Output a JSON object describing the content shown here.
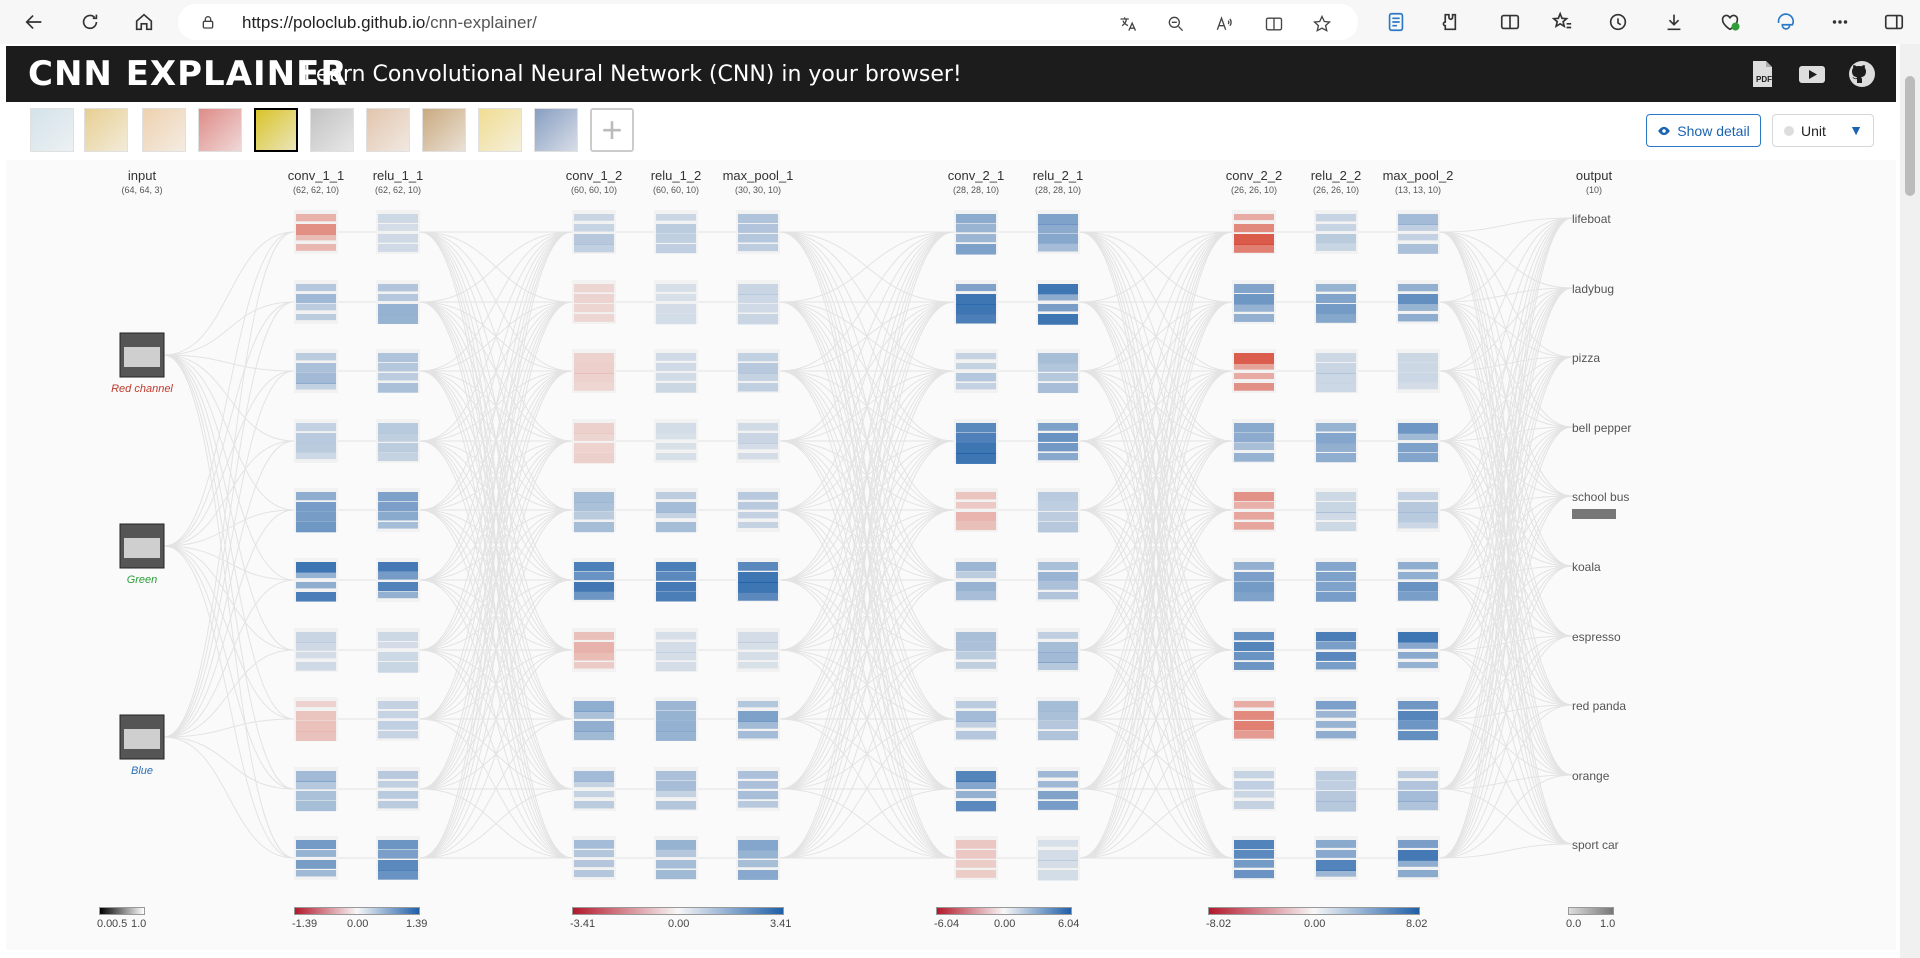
{
  "browser": {
    "url_host": "https://poloclub.github.io",
    "url_path": "/cnn-explainer/"
  },
  "header": {
    "title": "CNN EXPLAINER",
    "subtitle": "Learn Convolutional Neural Network (CNN) in your browser!"
  },
  "controls": {
    "show_detail": "Show detail",
    "unit_value": "Unit"
  },
  "images": [
    {
      "name": "lifeboat",
      "color": "#b7d0dc"
    },
    {
      "name": "ladybug",
      "color": "#d9b04a"
    },
    {
      "name": "pizza",
      "color": "#e3b37a"
    },
    {
      "name": "bell pepper",
      "color": "#c9403a"
    },
    {
      "name": "school bus",
      "color": "#d9c42a",
      "selected": true
    },
    {
      "name": "koala",
      "color": "#9a9a9a"
    },
    {
      "name": "espresso",
      "color": "#cf9f77"
    },
    {
      "name": "red panda",
      "color": "#a7722c"
    },
    {
      "name": "orange",
      "color": "#e8c74b"
    },
    {
      "name": "sport car",
      "color": "#3a5f9a"
    }
  ],
  "layers": [
    {
      "name": "input",
      "dim": "(64, 64, 3)"
    },
    {
      "name": "conv_1_1",
      "dim": "(62, 62, 10)"
    },
    {
      "name": "relu_1_1",
      "dim": "(62, 62, 10)"
    },
    {
      "name": "conv_1_2",
      "dim": "(60, 60, 10)"
    },
    {
      "name": "relu_1_2",
      "dim": "(60, 60, 10)"
    },
    {
      "name": "max_pool_1",
      "dim": "(30, 30, 10)"
    },
    {
      "name": "conv_2_1",
      "dim": "(28, 28, 10)"
    },
    {
      "name": "relu_2_1",
      "dim": "(28, 28, 10)"
    },
    {
      "name": "conv_2_2",
      "dim": "(26, 26, 10)"
    },
    {
      "name": "relu_2_2",
      "dim": "(26, 26, 10)"
    },
    {
      "name": "max_pool_2",
      "dim": "(13, 13, 10)"
    },
    {
      "name": "output",
      "dim": "(10)"
    }
  ],
  "channels": [
    {
      "label": "Red channel",
      "color": "#c0392b"
    },
    {
      "label": "Green",
      "color": "#2e9d3a"
    },
    {
      "label": "Blue",
      "color": "#2a6fb5"
    }
  ],
  "classes": [
    "lifeboat",
    "ladybug",
    "pizza",
    "bell pepper",
    "school bus",
    "koala",
    "espresso",
    "red panda",
    "orange",
    "sport car"
  ],
  "prediction": "school bus",
  "legends": [
    {
      "labels": [
        "0.0",
        "0.5",
        "1.0"
      ]
    },
    {
      "labels": [
        "-1.39",
        "0.00",
        "1.39"
      ]
    },
    {
      "labels": [
        "-3.41",
        "0.00",
        "3.41"
      ]
    },
    {
      "labels": [
        "-6.04",
        "0.00",
        "6.04"
      ]
    },
    {
      "labels": [
        "-8.02",
        "0.00",
        "8.02"
      ]
    },
    {
      "labels": [
        "0.0",
        "1.0"
      ]
    }
  ],
  "colors": {
    "positive": "#1f5fa8",
    "negative": "#d6402c",
    "header_bg": "#1c1c1c",
    "accent": "#2a79c7"
  }
}
